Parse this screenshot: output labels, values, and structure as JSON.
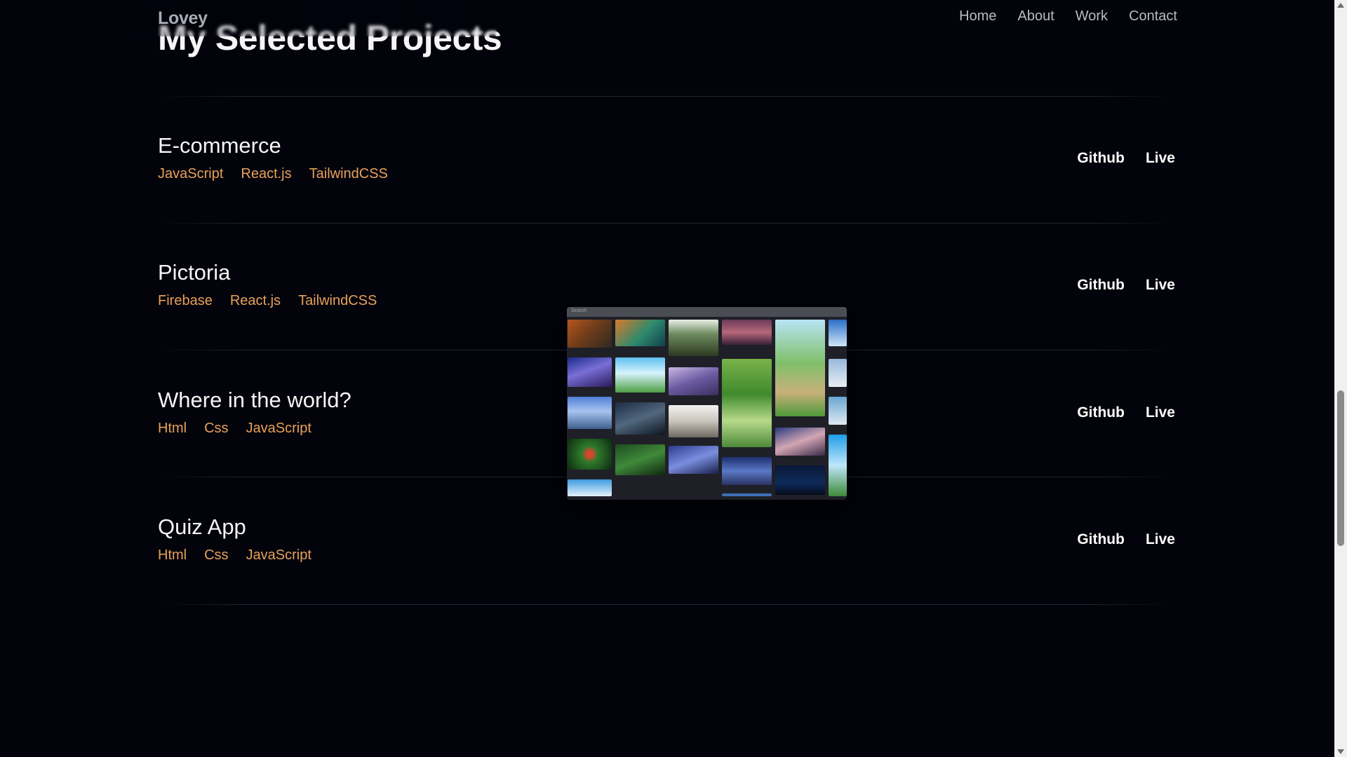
{
  "header": {
    "logo": "Lovey",
    "nav": [
      "Home",
      "About",
      "Work",
      "Contact"
    ]
  },
  "section_heading": "My Selected Projects",
  "projects": [
    {
      "title": "E-commerce",
      "tags": [
        "JavaScript",
        "React.js",
        "TailwindCSS"
      ],
      "links": [
        "Github",
        "Live"
      ]
    },
    {
      "title": "Pictoria",
      "tags": [
        "Firebase",
        "React.js",
        "TailwindCSS"
      ],
      "links": [
        "Github",
        "Live"
      ]
    },
    {
      "title": "Where in the world?",
      "tags": [
        "Html",
        "Css",
        "JavaScript"
      ],
      "links": [
        "Github",
        "Live"
      ]
    },
    {
      "title": "Quiz App",
      "tags": [
        "Html",
        "Css",
        "JavaScript"
      ],
      "links": [
        "Github",
        "Live"
      ]
    }
  ],
  "preview": {
    "search_text": "Search"
  },
  "colors": {
    "background": "#02030b",
    "tag": "#e8a15a",
    "link": "#ffffff",
    "nav": "#b9bcc4"
  }
}
